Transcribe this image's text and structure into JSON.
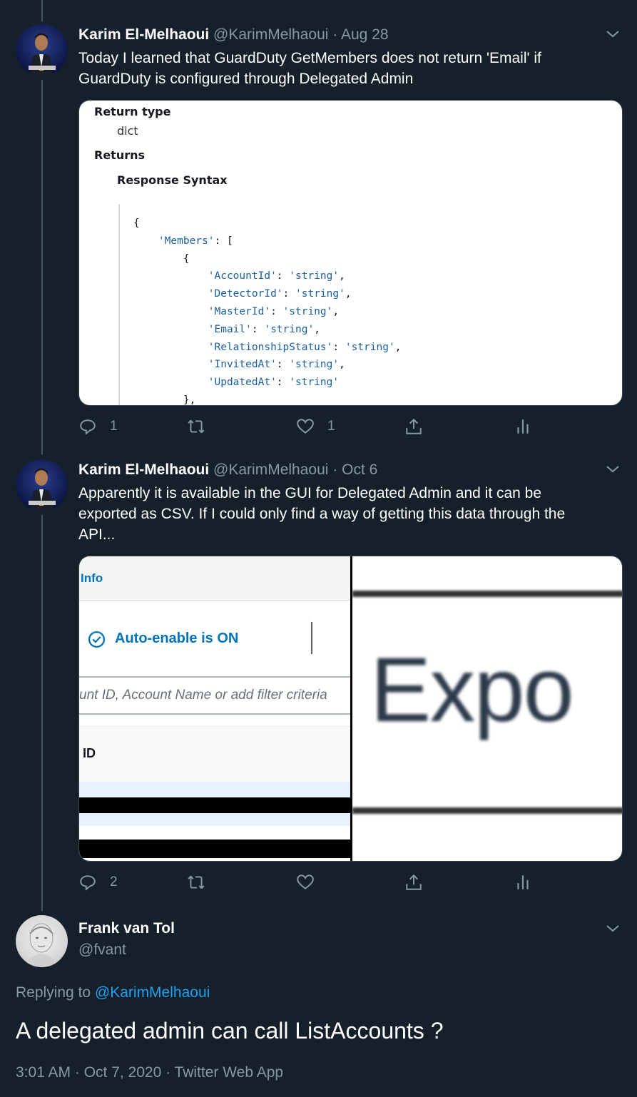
{
  "tweets": [
    {
      "name": "Karim El-Melhaoui",
      "handle": "@KarimMelhaoui",
      "sep": "·",
      "date": "Aug 28",
      "text_line1": "Today I learned that GuardDuty GetMembers does not return 'Email' if",
      "text_line2": "GuardDuty is configured through Delegated Admin",
      "media": {
        "return_type_label": "Return type",
        "return_type_value": "dict",
        "returns_label": "Returns",
        "response_syntax_label": "Response Syntax",
        "code_lines": [
          {
            "indent": "",
            "key": "",
            "text": "{"
          },
          {
            "indent": "    ",
            "key": "'Members'",
            "text": ": ["
          },
          {
            "indent": "        ",
            "key": "",
            "text": "{"
          },
          {
            "indent": "            ",
            "key": "'AccountId'",
            "text": ": ",
            "val": "'string'",
            "end": ","
          },
          {
            "indent": "            ",
            "key": "'DetectorId'",
            "text": ": ",
            "val": "'string'",
            "end": ","
          },
          {
            "indent": "            ",
            "key": "'MasterId'",
            "text": ": ",
            "val": "'string'",
            "end": ","
          },
          {
            "indent": "            ",
            "key": "'Email'",
            "text": ": ",
            "val": "'string'",
            "end": ","
          },
          {
            "indent": "            ",
            "key": "'RelationshipStatus'",
            "text": ": ",
            "val": "'string'",
            "end": ","
          },
          {
            "indent": "            ",
            "key": "'InvitedAt'",
            "text": ": ",
            "val": "'string'",
            "end": ","
          },
          {
            "indent": "            ",
            "key": "'UpdatedAt'",
            "text": ": ",
            "val": "'string'",
            "end": ""
          },
          {
            "indent": "        ",
            "key": "",
            "text": "},"
          }
        ]
      },
      "reply_count": "1",
      "like_count": "1"
    },
    {
      "name": "Karim El-Melhaoui",
      "handle": "@KarimMelhaoui",
      "sep": "·",
      "date": "Oct 6",
      "text_line1": "Apparently it is available in the GUI for Delegated Admin and it can be",
      "text_line2": "exported as CSV. If I could only find a way of getting this data through the",
      "text_line3": "API...",
      "media": {
        "info_label": "Info",
        "auto_enable_label": "Auto-enable is ON",
        "filter_placeholder": "unt ID, Account Name or add filter criteria",
        "id_header": "ID",
        "export_text": "Expo"
      },
      "reply_count": "2",
      "like_count": ""
    }
  ],
  "main_tweet": {
    "name": "Frank van Tol",
    "handle": "@fvant",
    "replying_prefix": "Replying to",
    "replying_to": "@KarimMelhaoui",
    "text": "A delegated admin can call ListAccounts ?",
    "meta": "3:01 AM · Oct 7, 2020 · Twitter Web App"
  },
  "colors": {
    "background": "#15202b",
    "secondary_text": "#8899a6",
    "link": "#1da1f2",
    "thread_line": "#3d5466"
  },
  "icons": [
    "reply-icon",
    "retweet-icon",
    "like-icon",
    "share-icon",
    "analytics-icon",
    "chevron-down-icon",
    "check-circle-icon"
  ]
}
